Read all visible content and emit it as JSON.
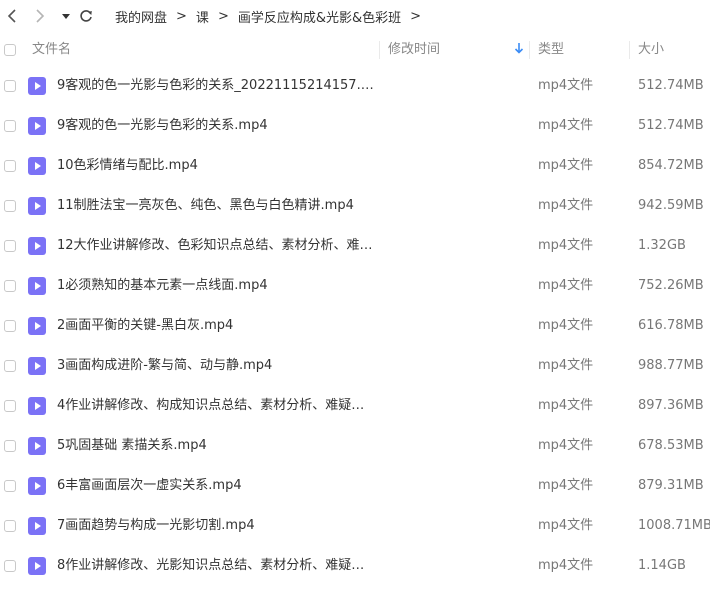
{
  "toolbar": {
    "back_icon": "chevron-left-icon",
    "forward_icon": "chevron-right-icon",
    "history_icon": "caret-down-icon",
    "refresh_icon": "refresh-icon"
  },
  "breadcrumb": {
    "items": [
      "我的网盘",
      "课",
      "画学反应构成&光影&色彩班"
    ],
    "separator": ">"
  },
  "columns": {
    "name": "文件名",
    "modified": "修改时间",
    "type": "类型",
    "size": "大小",
    "sort_icon": "arrow-down-icon",
    "sort_color": "#3b8cf5"
  },
  "icon_color": "#7b72f6",
  "files": [
    {
      "name": "9客观的色一光影与色彩的关系_20221115214157.mp4",
      "type": "mp4文件",
      "size": "512.74MB"
    },
    {
      "name": "9客观的色一光影与色彩的关系.mp4",
      "type": "mp4文件",
      "size": "512.74MB"
    },
    {
      "name": "10色彩情绪与配比.mp4",
      "type": "mp4文件",
      "size": "854.72MB"
    },
    {
      "name": "11制胜法宝一亮灰色、纯色、黑色与白色精讲.mp4",
      "type": "mp4文件",
      "size": "942.59MB"
    },
    {
      "name": "12大作业讲解修改、色彩知识点总结、素材分析、难疑解...",
      "type": "mp4文件",
      "size": "1.32GB"
    },
    {
      "name": "1必须熟知的基本元素一点线面.mp4",
      "type": "mp4文件",
      "size": "752.26MB"
    },
    {
      "name": "2画面平衡的关键-黑白灰.mp4",
      "type": "mp4文件",
      "size": "616.78MB"
    },
    {
      "name": "3画面构成进阶-繁与简、动与静.mp4",
      "type": "mp4文件",
      "size": "988.77MB"
    },
    {
      "name": "4作业讲解修改、构成知识点总结、素材分析、难疑解答....",
      "type": "mp4文件",
      "size": "897.36MB"
    },
    {
      "name": "5巩固基础 素描关系.mp4",
      "type": "mp4文件",
      "size": "678.53MB"
    },
    {
      "name": "6丰富画面层次一虚实关系.mp4",
      "type": "mp4文件",
      "size": "879.31MB"
    },
    {
      "name": "7画面趋势与构成一光影切割.mp4",
      "type": "mp4文件",
      "size": "1008.71MB"
    },
    {
      "name": "8作业讲解修改、光影知识点总结、素材分析、难疑解答....",
      "type": "mp4文件",
      "size": "1.14GB"
    }
  ]
}
